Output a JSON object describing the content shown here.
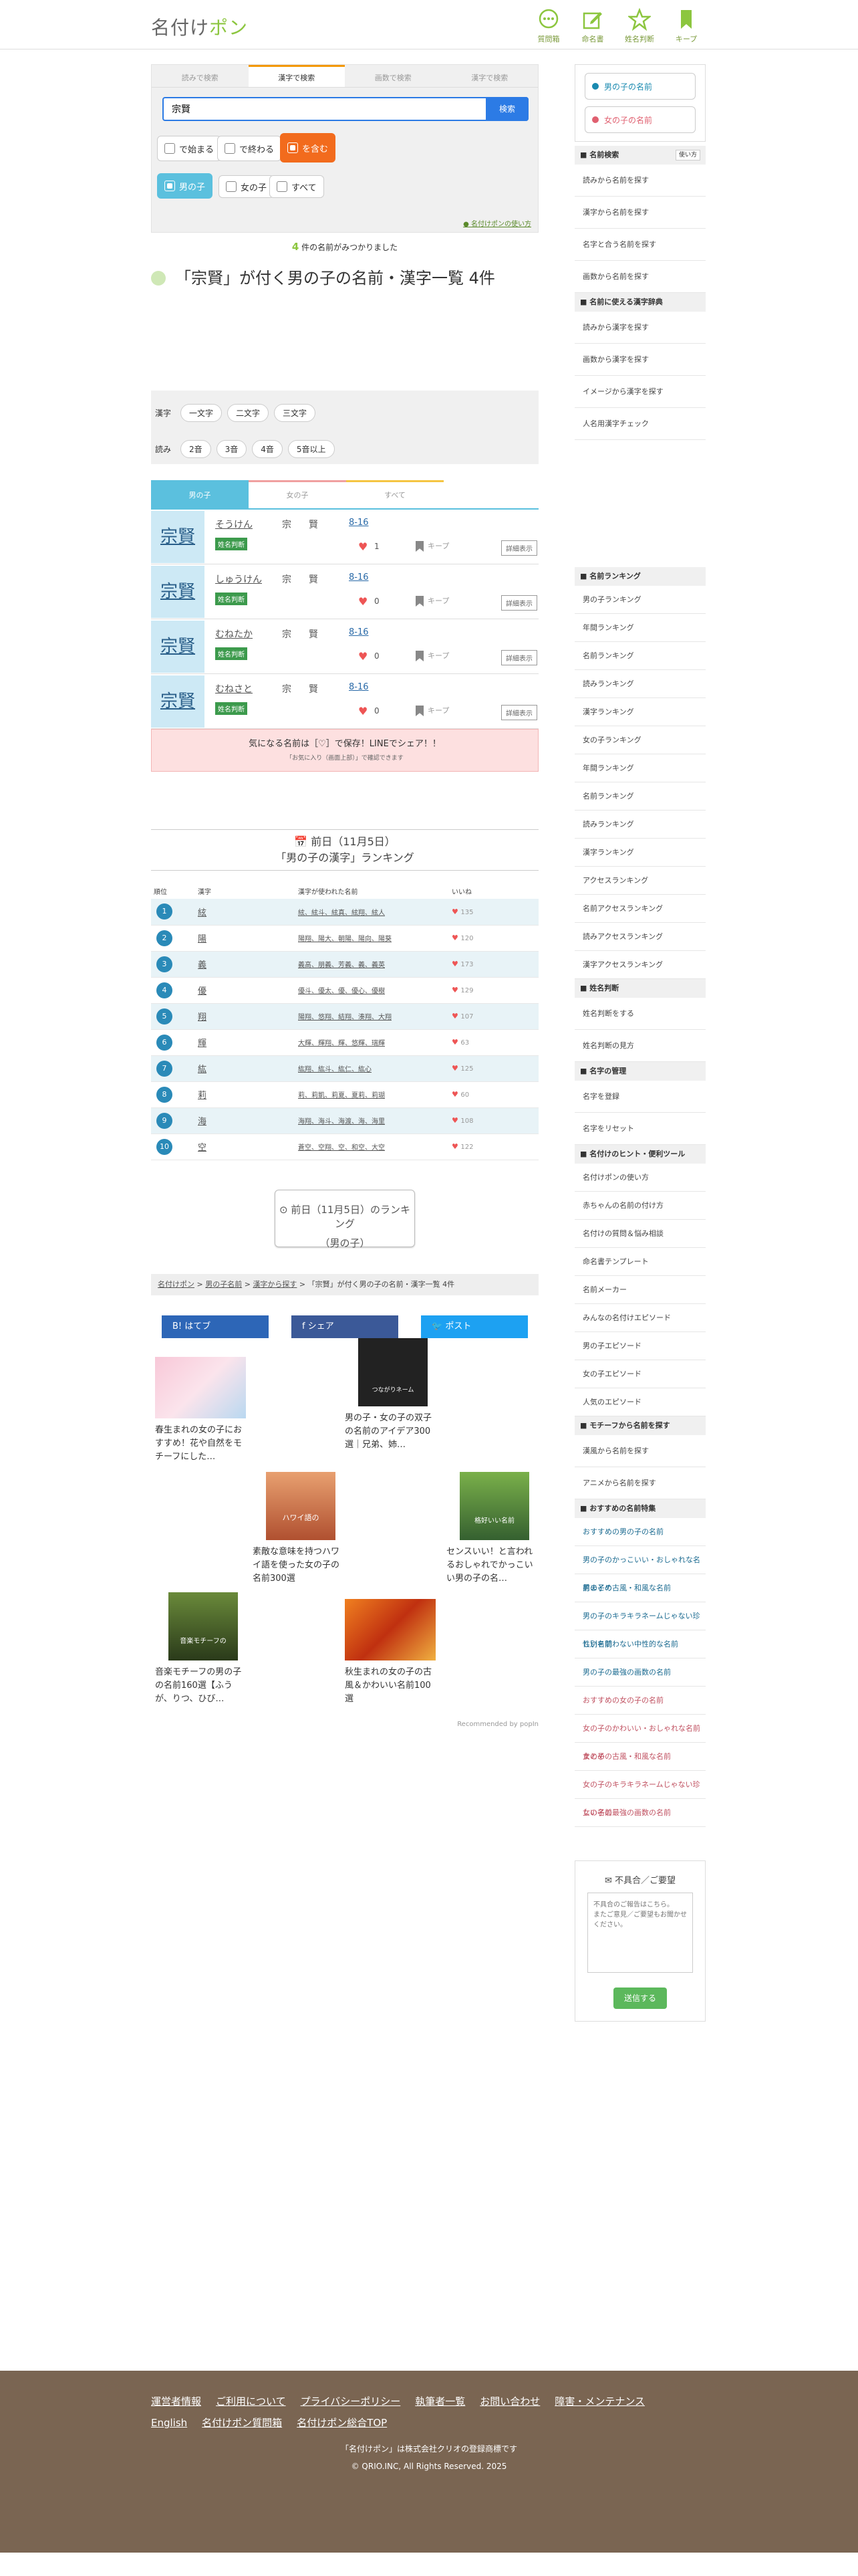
{
  "header": {
    "logo_a": "名付け",
    "logo_b": "ポン",
    "nav": [
      {
        "label": "質問箱",
        "icon": "chat-icon"
      },
      {
        "label": "命名書",
        "icon": "edit-icon"
      },
      {
        "label": "姓名判断",
        "icon": "star-icon"
      },
      {
        "label": "キープ",
        "icon": "bookmark-icon"
      }
    ]
  },
  "search": {
    "tabs": [
      "読みで検索",
      "漢字で検索",
      "画数で検索",
      "漢字で検索"
    ],
    "active_tab": 1,
    "query": "宗賢",
    "button": "検索",
    "opts": [
      "で始まる",
      "で終わる",
      "を含む"
    ],
    "gender": [
      "男の子",
      "女の子",
      "すべて"
    ],
    "usage_link": "名付けポンの使い方",
    "count": "4",
    "found_text": " 件の名前がみつかりました"
  },
  "title": "「宗賢」が付く男の子の名前・漢字一覧 4件",
  "filter": {
    "kanji_label": "漢字",
    "kanji_opts": [
      "一文字",
      "二文字",
      "三文字"
    ],
    "read_label": "読み",
    "read_opts": [
      "2音",
      "3音",
      "4音",
      "5音以上"
    ]
  },
  "gender_tabs": [
    "男の子",
    "女の子",
    "すべて"
  ],
  "results": [
    {
      "kanji": "宗賢",
      "reading": "そうけん",
      "k1": "宗",
      "k2": "賢",
      "strokes": "8-16",
      "likes": "1"
    },
    {
      "kanji": "宗賢",
      "reading": "しゅうけん",
      "k1": "宗",
      "k2": "賢",
      "strokes": "8-16",
      "likes": "0"
    },
    {
      "kanji": "宗賢",
      "reading": "むねたか",
      "k1": "宗",
      "k2": "賢",
      "strokes": "8-16",
      "likes": "0"
    },
    {
      "kanji": "宗賢",
      "reading": "むねさと",
      "k1": "宗",
      "k2": "賢",
      "strokes": "8-16",
      "likes": "0"
    }
  ],
  "row_labels": {
    "seimei": "姓名判断",
    "keep": "キープ",
    "detail": "詳細表示"
  },
  "line_box": {
    "t1": "気になる名前は［♡］で保存！LINEでシェア！！",
    "t2": "「お気に入り（画面上部）」で確認できます"
  },
  "ranking": {
    "date": "前日（11月5日）",
    "subtitle": "「男の子の漢字」ランキング",
    "headers": [
      "順位",
      "漢字",
      "漢字が使われた名前",
      "いいね"
    ],
    "rows": [
      {
        "n": "1",
        "k": "絃",
        "names": "絃、絃斗、絃真、絃翔、絃人",
        "likes": "135"
      },
      {
        "n": "2",
        "k": "陽",
        "names": "陽翔、陽大、朝陽、陽向、陽葵",
        "likes": "120"
      },
      {
        "n": "3",
        "k": "義",
        "names": "義高、朋義、芳義、義、義英",
        "likes": "173"
      },
      {
        "n": "4",
        "k": "優",
        "names": "優斗、優太、優、優心、優樹",
        "likes": "129"
      },
      {
        "n": "5",
        "k": "翔",
        "names": "陽翔、悠翔、結翔、湊翔、大翔",
        "likes": "107"
      },
      {
        "n": "6",
        "k": "輝",
        "names": "大輝、輝翔、輝、悠輝、瑞輝",
        "likes": "63"
      },
      {
        "n": "7",
        "k": "紘",
        "names": "紘翔、紘斗、紘仁、紘心",
        "likes": "125"
      },
      {
        "n": "8",
        "k": "莉",
        "names": "莉、莉凱、莉夏、夏莉、莉瑚",
        "likes": "60"
      },
      {
        "n": "9",
        "k": "海",
        "names": "海翔、海斗、海渡、海、海里",
        "likes": "108"
      },
      {
        "n": "10",
        "k": "空",
        "names": "蒼空、空翔、空、和空、大空",
        "likes": "122"
      }
    ],
    "prev_btn_1": "前日（11月5日）のランキング",
    "prev_btn_2": "（男の子）"
  },
  "breadcrumb": [
    "名付けポン",
    "男の子名前",
    "漢字から探す",
    "「宗賢」が付く男の子の名前・漢字一覧 4件"
  ],
  "share": [
    "はてブ",
    "シェア",
    "ポスト"
  ],
  "recs": [
    {
      "title": "春生まれの女の子におすすめ！花や自然をモチーフにした…",
      "img": "cherry-blossom-image"
    },
    {
      "title": "男の子・女の子の双子の名前のアイデア300選｜兄弟、姉…",
      "img": "twins-image",
      "cap": "双子・兄弟姉妹の子の\nつながりネーム"
    },
    {
      "title": "素敵な意味を持つハワイ語を使った女の子の名前300選",
      "img": "hawaii-image",
      "cap": "ハワイ語の\n女の子の名前"
    },
    {
      "title": "センスいい！と言われるおしゃれでかっこいい男の子の名…",
      "img": "boy-image",
      "cap": "センスがいいと言われる\n格好いい名前"
    },
    {
      "title": "音楽モチーフの男の子の名前160選【ふうが、りつ、ひび…",
      "img": "music-image",
      "cap": "音楽モチーフの\n男の子の名前"
    },
    {
      "title": "秋生まれの女の子の古風＆かわいい名前100選",
      "img": "autumn-image"
    }
  ],
  "recommended_by": "Recommended by popIn",
  "side": {
    "boy": "男の子の名前",
    "girl": "女の子の名前",
    "search_h": "名前検索",
    "help": "使い方",
    "search_items": [
      "読みから名前を探す",
      "漢字から名前を探す",
      "名字と合う名前を探す",
      "画数から名前を探す"
    ],
    "dict_h": "名前に使える漢字辞典",
    "dict_items": [
      "読みから漢字を探す",
      "画数から漢字を探す",
      "イメージから漢字を探す",
      "人名用漢字チェック"
    ],
    "rank_h": "名前ランキング",
    "rank_boy": [
      "男の子ランキング",
      "年間ランキング",
      "名前ランキング",
      "読みランキング",
      "漢字ランキング"
    ],
    "rank_girl": [
      "女の子ランキング",
      "年間ランキング",
      "名前ランキング",
      "読みランキング",
      "漢字ランキング"
    ],
    "rank_acc": [
      "アクセスランキング",
      "名前アクセスランキング",
      "読みアクセスランキング",
      "漢字アクセスランキング"
    ],
    "seimei_h": "姓名判断",
    "seimei_items": [
      "姓名判断をする",
      "姓名判断の見方"
    ],
    "myoji_h": "名字の管理",
    "myoji_items": [
      "名字を登録",
      "名字をリセット"
    ],
    "hint_h": "名付けのヒント・便利ツール",
    "hint_items": [
      "名付けポンの使い方",
      "赤ちゃんの名前の付け方",
      "名付けの質問＆悩み相談",
      "命名書テンプレート",
      "名前メーカー",
      "みんなの名付けエピソード",
      "男の子エピソード",
      "女の子エピソード",
      "人気のエピソード"
    ],
    "motif_h": "モチーフから名前を探す",
    "motif_items": [
      "漢風から名前を探す",
      "アニメから名前を探す"
    ],
    "osusume_h": "おすすめの名前特集",
    "boy_feat": [
      "おすすめの男の子の名前",
      "男の子のかっこいい・おしゃれな名前まとめ",
      "男の子の古風・和風な名前",
      "男の子のキラキラネームじゃない珍しい名前",
      "性別を問わない中性的な名前",
      "男の子の最強の画数の名前"
    ],
    "girl_feat": [
      "おすすめの女の子の名前",
      "女の子のかわいい・おしゃれな名前まとめ",
      "女の子の古風・和風な名前",
      "女の子のキラキラネームじゃない珍しい名前",
      "女の子の最強の画数の名前"
    ],
    "feedback_h": "不具合／ご要望",
    "feedback_ph": "不具合のご報告はこちら。\nまたご意見／ご要望もお聞かせください。",
    "submit": "送信する"
  },
  "footer": {
    "links": [
      "運営者情報",
      "ご利用について",
      "プライバシーポリシー",
      "執筆者一覧",
      "お問い合わせ",
      "障害・メンテナンス",
      "English",
      "名付けポン質問箱",
      "名付けポン総合TOP"
    ],
    "copy1": "「名付けポン」は株式会社クリオの登録商標です",
    "copy2": "© QRIO.INC, All Rights Reserved. 2025"
  },
  "colors": {
    "accent": "#8cc63f",
    "blue": "#2c7be5",
    "orange": "#f26b1d",
    "teal": "#5bc0de",
    "footer": "#7a6552"
  }
}
